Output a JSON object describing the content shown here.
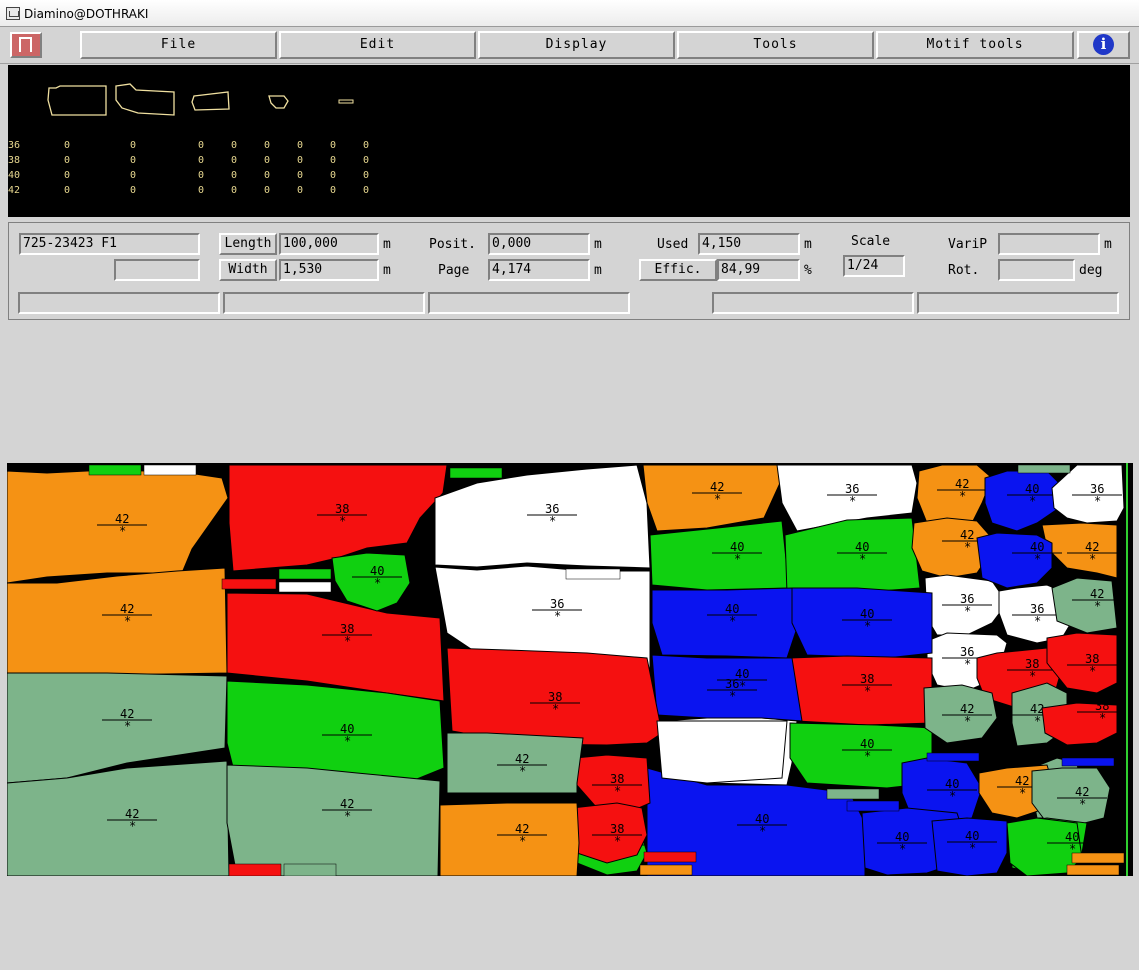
{
  "window": {
    "title": "Diamino@DOTHRAKI"
  },
  "menu": [
    "File",
    "Edit",
    "Display",
    "Tools",
    "Motif tools"
  ],
  "preview": {
    "sizes": [
      "36",
      "38",
      "40",
      "42"
    ],
    "counts": [
      [
        "0",
        "0",
        "0",
        "0",
        "0",
        "0",
        "0",
        "0"
      ],
      [
        "0",
        "0",
        "0",
        "0",
        "0",
        "0",
        "0",
        "0"
      ],
      [
        "0",
        "0",
        "0",
        "0",
        "0",
        "0",
        "0",
        "0"
      ],
      [
        "0",
        "0",
        "0",
        "0",
        "0",
        "0",
        "0",
        "0"
      ]
    ]
  },
  "info": {
    "marker_name": "725-23423 F1",
    "length_label": "Length",
    "length_value": "100,000",
    "length_unit": "m",
    "width_label": "Width",
    "width_value": "1,530",
    "width_unit": "m",
    "posit_label": "Posit.",
    "posit_value": "0,000",
    "posit_unit": "m",
    "page_label": "Page",
    "page_value": "4,174",
    "page_unit": "m",
    "used_label": "Used",
    "used_value": "4,150",
    "used_unit": "m",
    "effic_label": "Effic.",
    "effic_value": "84,99",
    "effic_unit": "%",
    "scale_label": "Scale",
    "scale_value": "1/24",
    "varip_label": "VariP",
    "varip_value": "",
    "varip_unit": "m",
    "rot_label": "Rot.",
    "rot_value": "",
    "rot_unit": "deg"
  },
  "colors": {
    "orange": "#f59214",
    "red": "#f51010",
    "white": "#ffffff",
    "green": "#10d010",
    "blue": "#0a14f0",
    "sage": "#7db48a"
  },
  "pieces": [
    {
      "color": "orange",
      "size": "42"
    },
    {
      "color": "red",
      "size": "38"
    },
    {
      "color": "white",
      "size": "36"
    },
    {
      "color": "orange",
      "size": "42"
    },
    {
      "color": "white",
      "size": "36"
    },
    {
      "color": "orange",
      "size": "42"
    },
    {
      "color": "red",
      "size": "38"
    },
    {
      "color": "white",
      "size": "36"
    },
    {
      "color": "green",
      "size": "40"
    },
    {
      "color": "green",
      "size": "40"
    },
    {
      "color": "sage",
      "size": "42"
    },
    {
      "color": "orange",
      "size": "42"
    },
    {
      "color": "blue",
      "size": "40"
    },
    {
      "color": "orange",
      "size": "42"
    },
    {
      "color": "white",
      "size": "36"
    },
    {
      "color": "green",
      "size": "40"
    },
    {
      "color": "orange",
      "size": "42"
    },
    {
      "color": "white",
      "size": "36"
    },
    {
      "color": "blue",
      "size": "40"
    },
    {
      "color": "blue",
      "size": "40"
    },
    {
      "color": "white",
      "size": "36"
    },
    {
      "color": "white",
      "size": "36"
    },
    {
      "color": "sage",
      "size": "42"
    },
    {
      "color": "blue",
      "size": "40"
    },
    {
      "color": "green",
      "size": "40"
    },
    {
      "color": "red",
      "size": "38"
    },
    {
      "color": "red",
      "size": "38"
    },
    {
      "color": "red",
      "size": "38"
    },
    {
      "color": "white",
      "size": "36"
    },
    {
      "color": "blue",
      "size": "40"
    },
    {
      "color": "red",
      "size": "38"
    },
    {
      "color": "blue",
      "size": "40"
    },
    {
      "color": "green",
      "size": "40"
    },
    {
      "color": "sage",
      "size": "42"
    },
    {
      "color": "red",
      "size": "38"
    },
    {
      "color": "sage",
      "size": "42"
    },
    {
      "color": "white",
      "size": "36"
    },
    {
      "color": "green",
      "size": "40"
    },
    {
      "color": "sage",
      "size": "42"
    },
    {
      "color": "sage",
      "size": "42"
    },
    {
      "color": "sage",
      "size": "42"
    },
    {
      "color": "sage",
      "size": "42"
    },
    {
      "color": "red",
      "size": "38"
    },
    {
      "color": "blue",
      "size": "40"
    },
    {
      "color": "orange",
      "size": "42"
    },
    {
      "color": "sage",
      "size": "42"
    },
    {
      "color": "orange",
      "size": "42"
    },
    {
      "color": "green",
      "size": "40"
    },
    {
      "color": "blue",
      "size": "40"
    },
    {
      "color": "green",
      "size": "40"
    },
    {
      "color": "blue",
      "size": "40"
    },
    {
      "color": "green",
      "size": "40"
    },
    {
      "color": "red",
      "size": "38"
    }
  ]
}
